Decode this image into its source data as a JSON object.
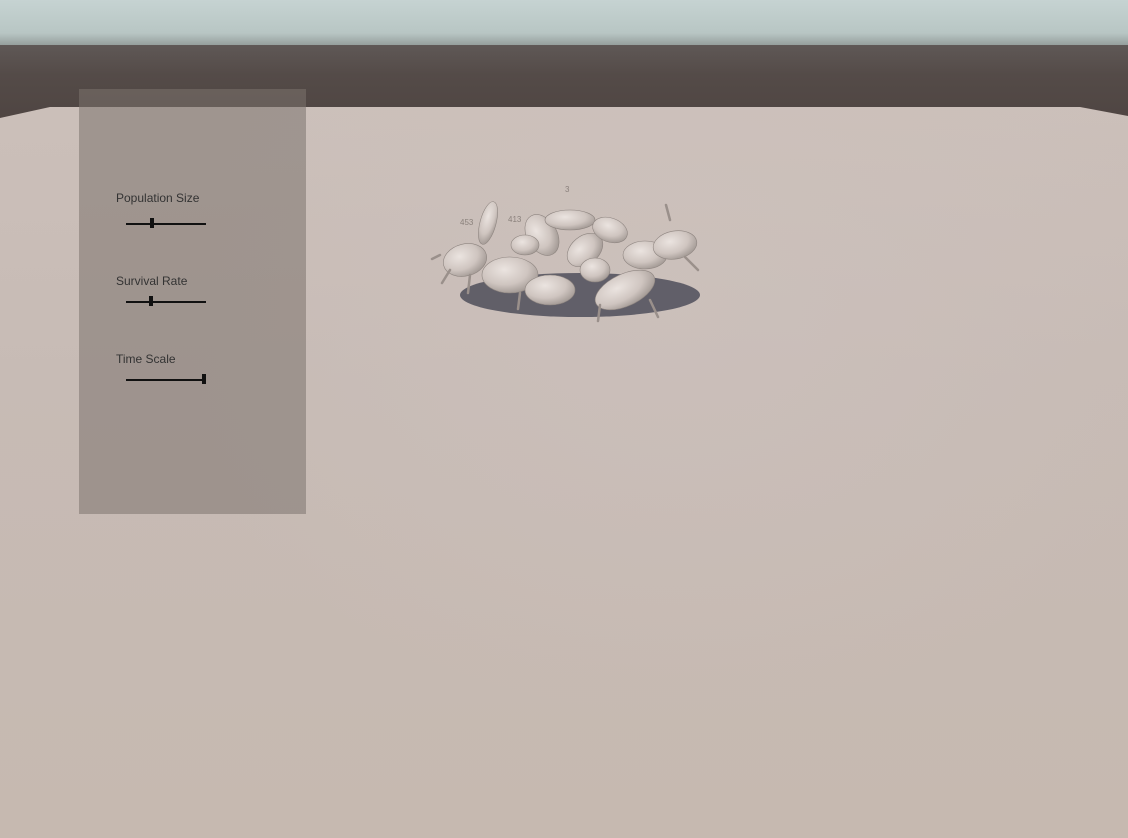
{
  "panel": {
    "sliders": [
      {
        "label": "Population Size",
        "value": 0.33
      },
      {
        "label": "Survival Rate",
        "value": 0.31
      },
      {
        "label": "Time Scale",
        "value": 0.97
      }
    ]
  },
  "scene": {
    "ground_color": "#c8bdb6",
    "creature_color": "#d4ccc7",
    "shadow_color": "#3a3c4a",
    "creature_labels": [
      "453",
      "413",
      "3"
    ]
  }
}
